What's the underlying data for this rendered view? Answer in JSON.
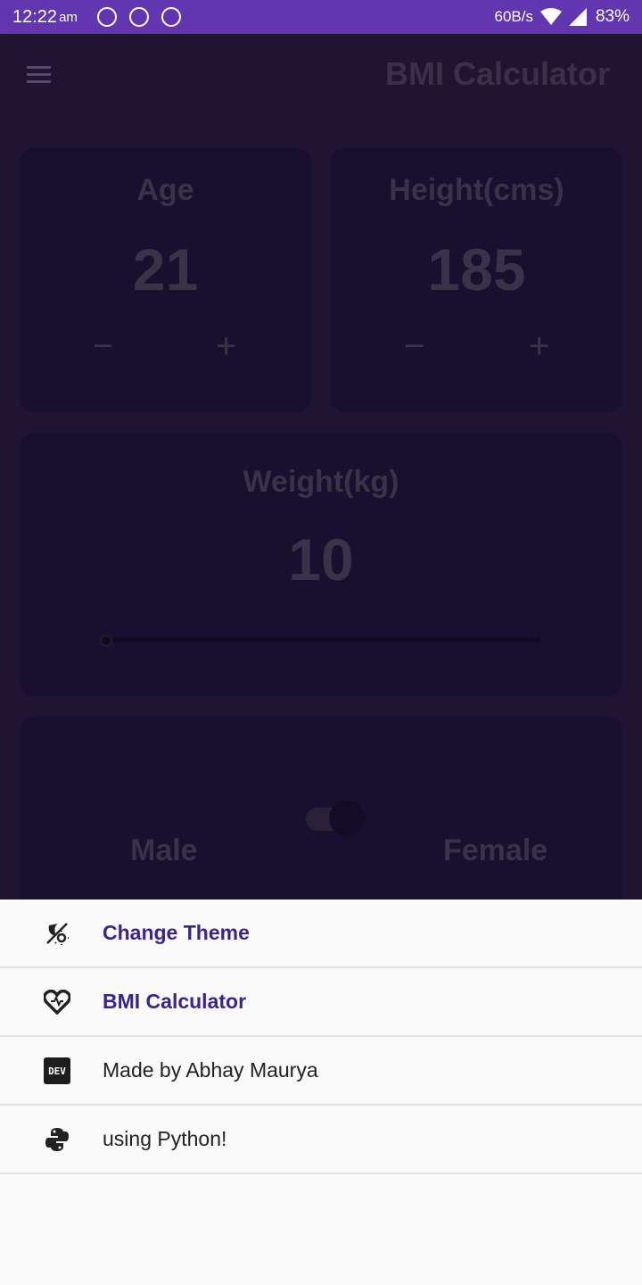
{
  "status_bar": {
    "time": "12:22",
    "ampm": "am",
    "net_speed": "60B/s",
    "battery": "83%"
  },
  "app_bar": {
    "title": "BMI Calculator",
    "menu_icon": "menu-icon"
  },
  "age": {
    "label": "Age",
    "value": "21",
    "minus": "−",
    "plus": "+"
  },
  "height": {
    "label": "Height(cms)",
    "value": "185",
    "minus": "−",
    "plus": "+"
  },
  "weight": {
    "label": "Weight(kg)",
    "value": "10",
    "slider_fraction": 0
  },
  "gender": {
    "male": "Male",
    "female": "Female",
    "switch_on": true
  },
  "drawer": {
    "items": [
      {
        "label": "Change Theme",
        "icon": "theme-light-dark-icon",
        "style": "accent"
      },
      {
        "label": "BMI Calculator",
        "icon": "heart-pulse-icon",
        "style": "accent"
      },
      {
        "label": "Made by Abhay Maurya",
        "icon": "dev-icon",
        "style": "plain",
        "badge": "DEV"
      },
      {
        "label": "using Python!",
        "icon": "python-icon",
        "style": "plain"
      }
    ]
  },
  "colors": {
    "status_bar": "#6236b0",
    "accent_text": "#3b248d",
    "drawer_bg": "#fafafa"
  }
}
